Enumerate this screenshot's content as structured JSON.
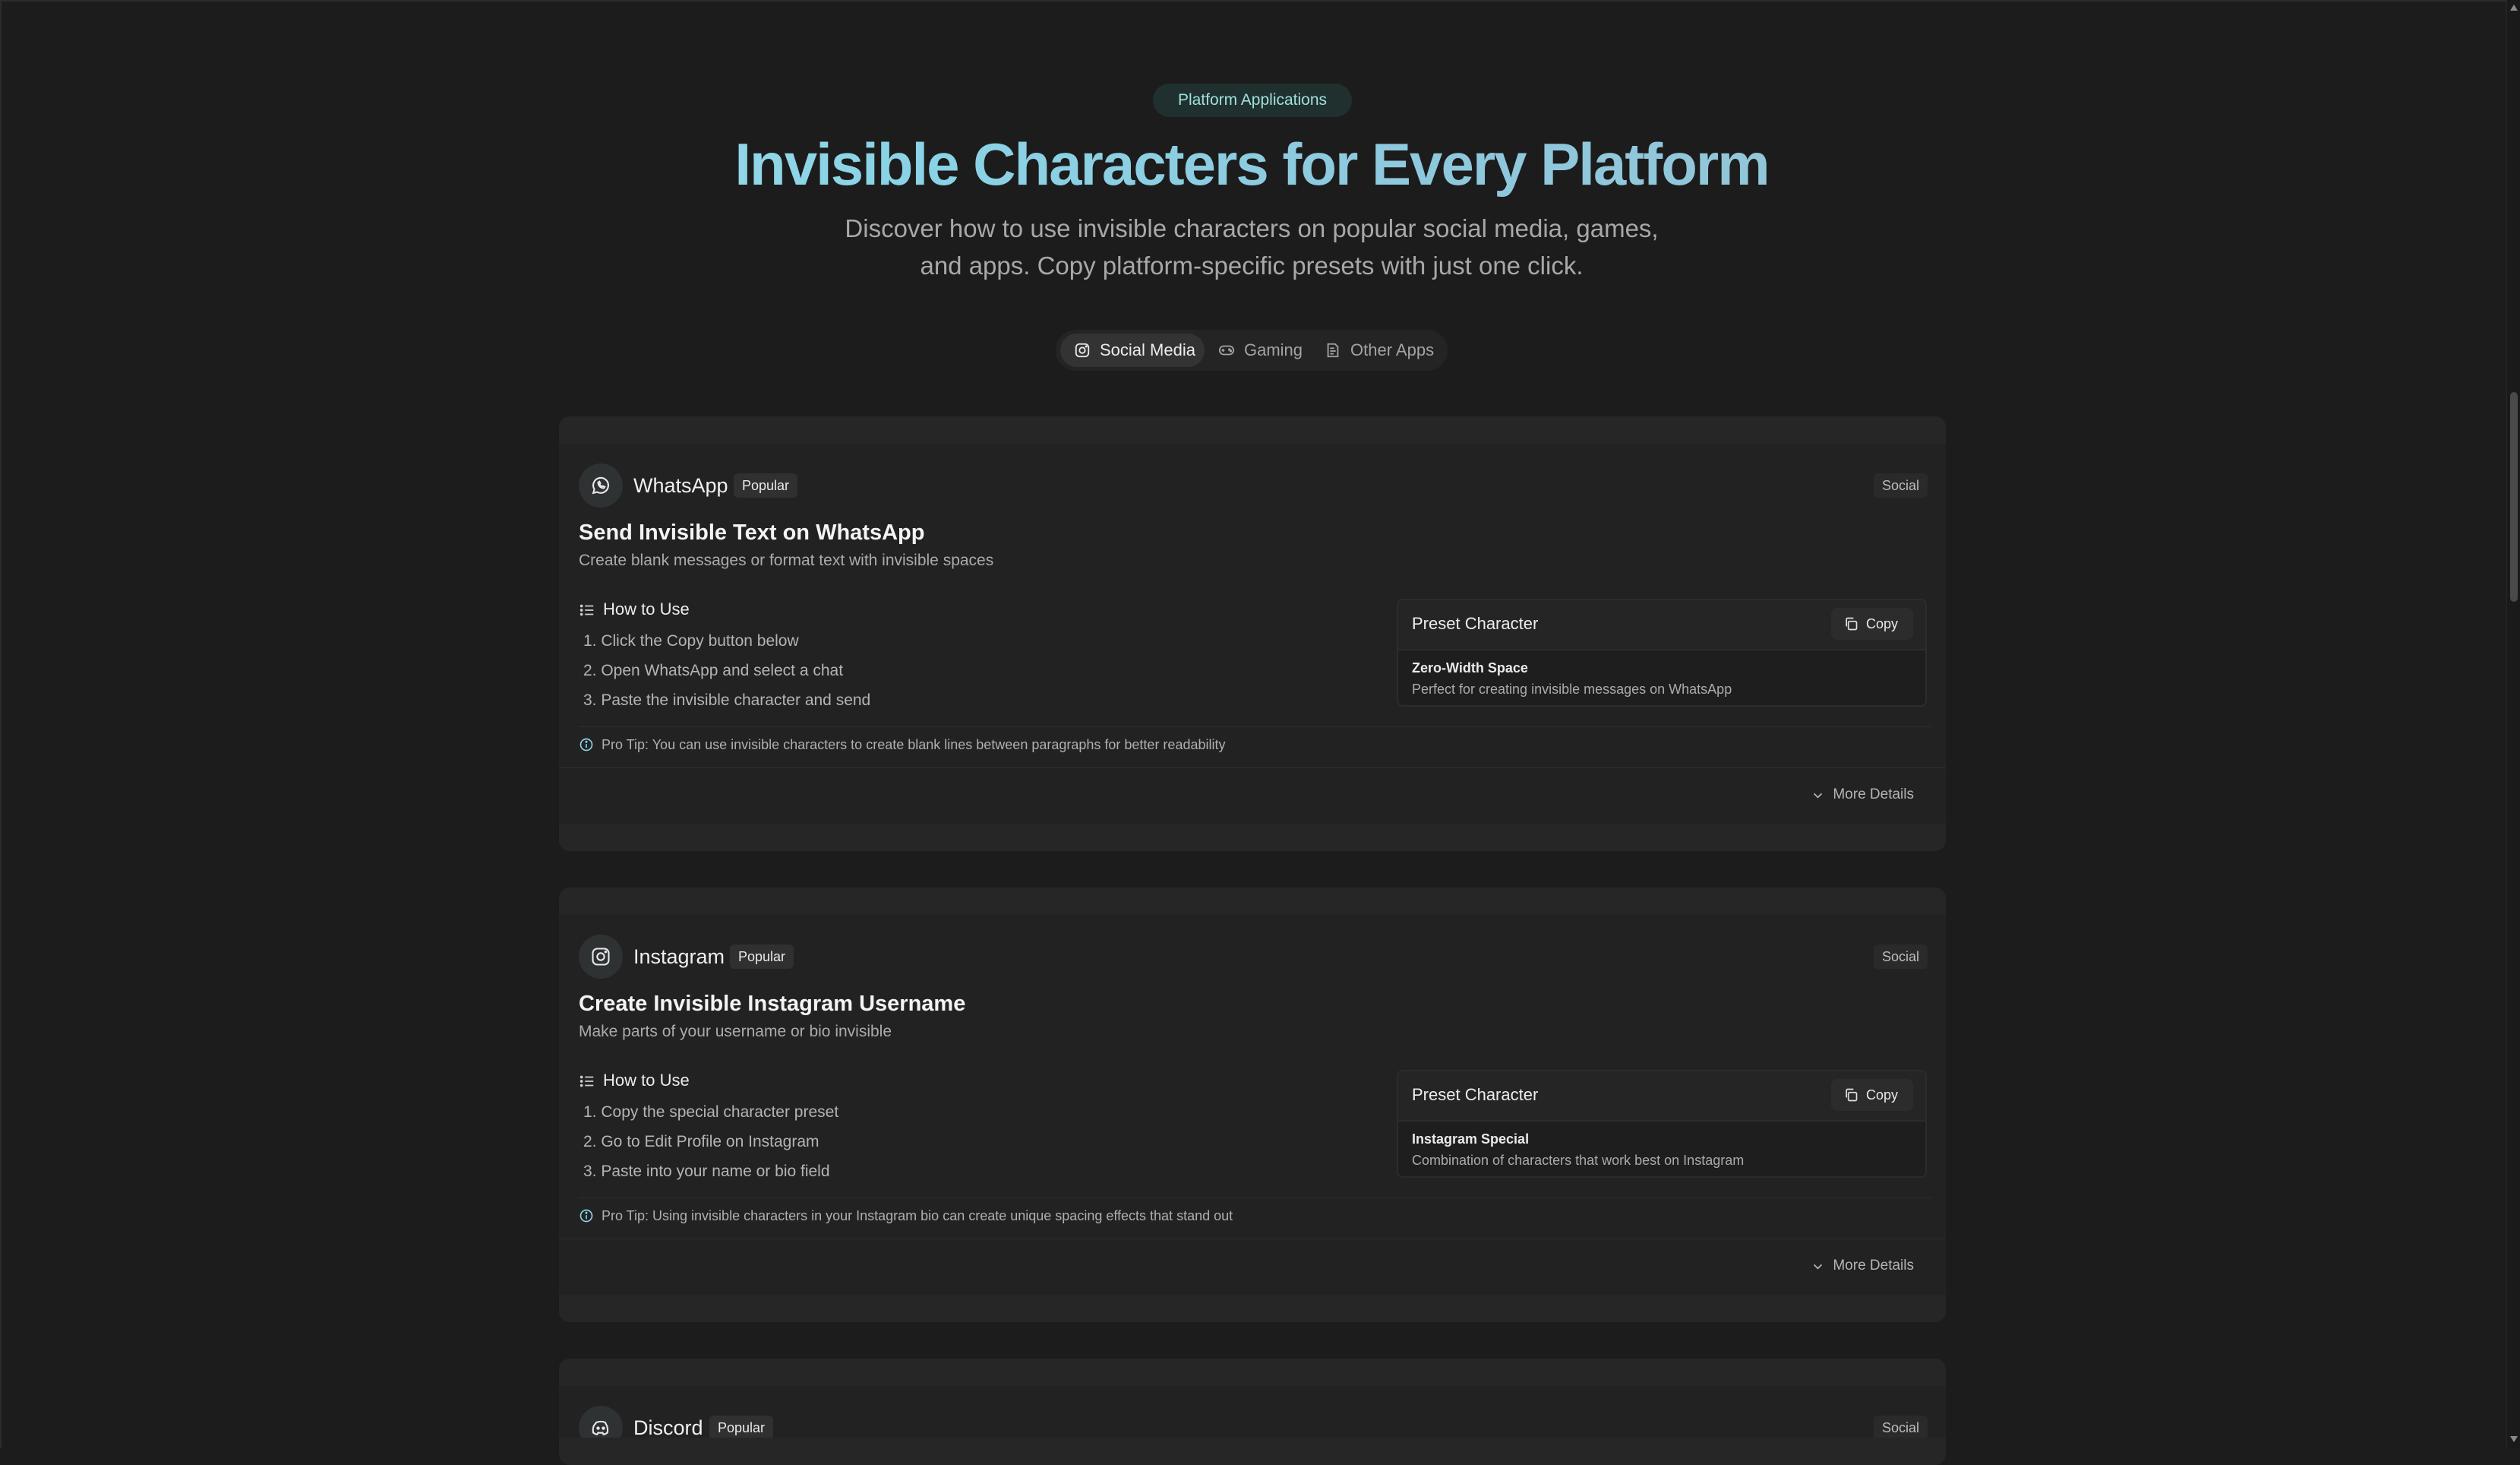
{
  "header": {
    "badge": "Platform Applications",
    "title": "Invisible Characters for Every Platform",
    "subtitle_line1": "Discover how to use invisible characters on popular social media, games,",
    "subtitle_line2": "and apps. Copy platform-specific presets with just one click."
  },
  "tabs": [
    {
      "label": "Social Media",
      "icon": "instagram-icon",
      "active": true
    },
    {
      "label": "Gaming",
      "icon": "gamepad-icon",
      "active": false
    },
    {
      "label": "Other Apps",
      "icon": "document-icon",
      "active": false
    }
  ],
  "common": {
    "how_to_label": "How to Use",
    "preset_label": "Preset Character",
    "copy_label": "Copy",
    "more_label": "More Details",
    "popular_label": "Popular",
    "category_label": "Social"
  },
  "cards": [
    {
      "platform": "WhatsApp",
      "icon": "whatsapp-icon",
      "title": "Send Invisible Text on WhatsApp",
      "description": "Create blank messages or format text with invisible spaces",
      "steps": [
        "1. Click the Copy button below",
        "2. Open WhatsApp and select a chat",
        "3. Paste the invisible character and send"
      ],
      "tip": "Pro Tip: You can use invisible characters to create blank lines between paragraphs for better readability",
      "preset_name": "Zero-Width Space",
      "preset_desc": "Perfect for creating invisible messages on WhatsApp"
    },
    {
      "platform": "Instagram",
      "icon": "instagram-icon",
      "title": "Create Invisible Instagram Username",
      "description": "Make parts of your username or bio invisible",
      "steps": [
        "1. Copy the special character preset",
        "2. Go to Edit Profile on Instagram",
        "3. Paste into your name or bio field"
      ],
      "tip": "Pro Tip: Using invisible characters in your Instagram bio can create unique spacing effects that stand out",
      "preset_name": "Instagram Special",
      "preset_desc": "Combination of characters that work best on Instagram"
    },
    {
      "platform": "Discord",
      "icon": "discord-icon"
    }
  ],
  "colors": {
    "background": "#1c1c1c",
    "card": "#222222",
    "accent": "#8ad3e6"
  }
}
